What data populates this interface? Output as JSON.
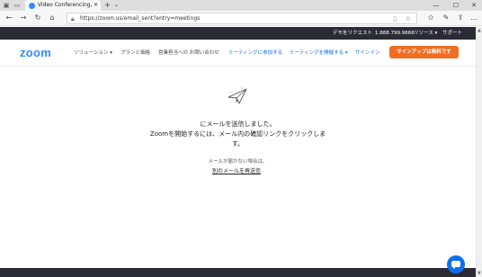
{
  "browser": {
    "tab_title": "Video Conferencing, We",
    "tab_close": "✕",
    "new_tab": "+",
    "tab_menu": "⌄",
    "url": "https://zoom.us/email_sent?entry=meetings",
    "back_icon": "←",
    "forward_icon": "→",
    "refresh_icon": "↻",
    "home_icon": "⌂",
    "minimize_icon": "—",
    "maximize_icon": "☐",
    "close_icon": "✕"
  },
  "top_strip": {
    "links": [
      "デモをリクエスト",
      "1.888.799.9666",
      "リソース ▾",
      "サポート"
    ]
  },
  "header": {
    "logo": "zoom",
    "menu": [
      "ソリューション ▾",
      "プランと価格",
      "営業担当への お問い合わせ"
    ],
    "actions": [
      "ミーティングに参加する",
      "ミーティングを開催する ▾",
      "サインイン"
    ],
    "signup_label": "サインアップは無料です"
  },
  "main": {
    "line1": "にメールを送信しました。",
    "line2": "Zoomを開始するには、メール内の確認リンクをクリックしま",
    "line3": "す。",
    "no_email": "メールが届かない場合は、",
    "resend_link": "別のメールを再送信"
  },
  "colors": {
    "accent_blue": "#0e71eb",
    "logo_blue": "#2d8cff",
    "signup_orange": "#f26d21",
    "dark_strip": "#2b2b36"
  }
}
